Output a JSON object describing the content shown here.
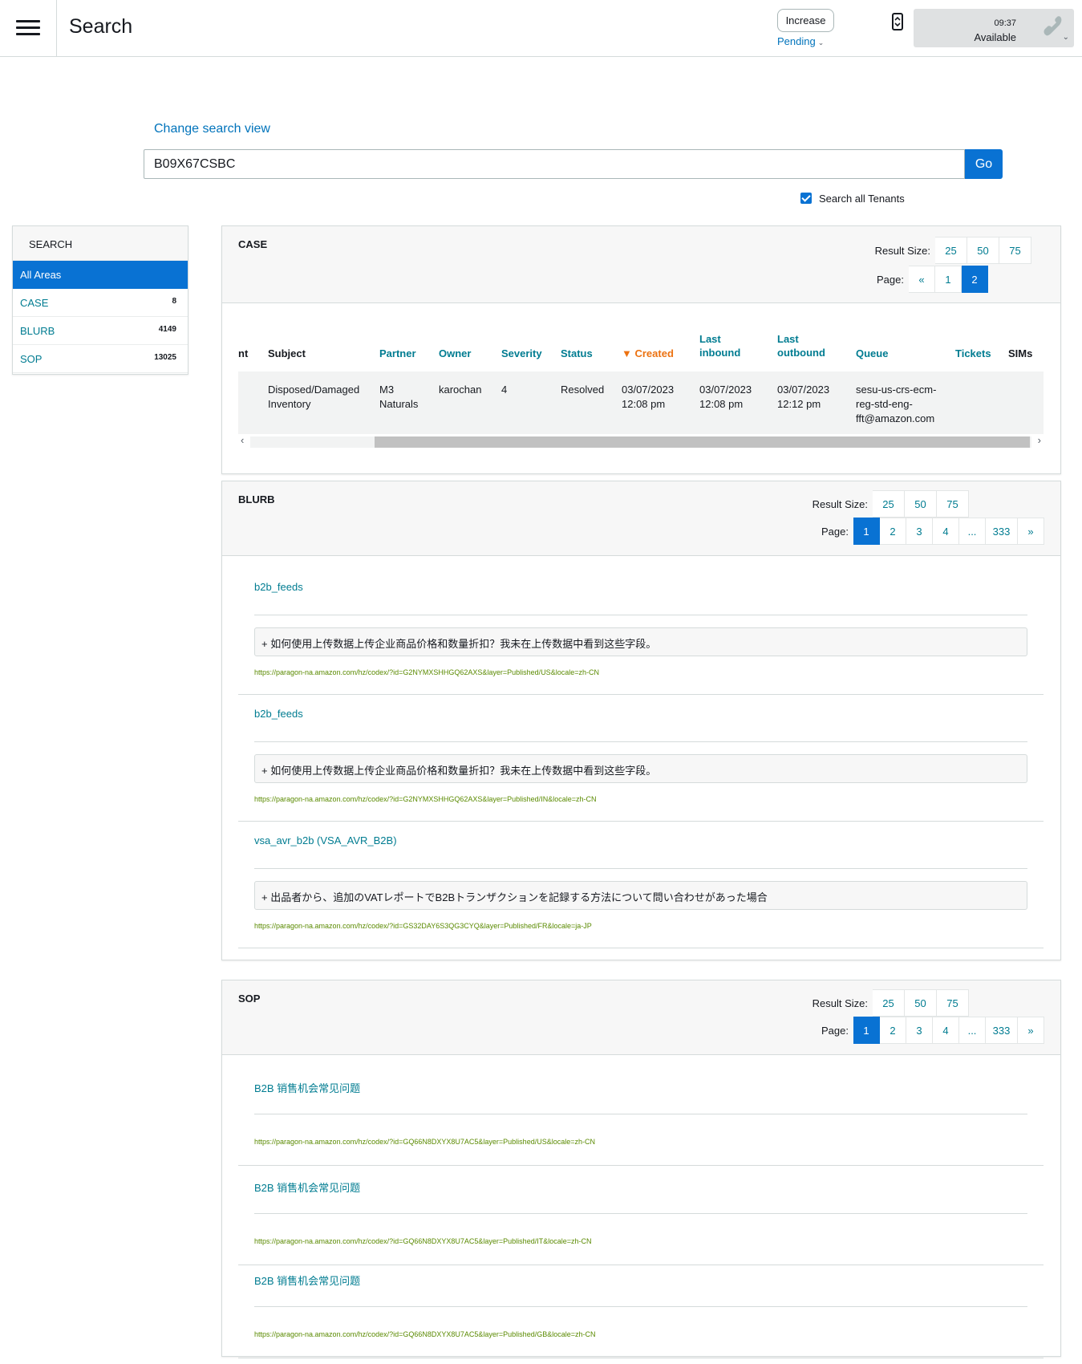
{
  "header": {
    "title": "Search",
    "increase_label": "Increase",
    "pending_label": "Pending",
    "status_time": "09:37",
    "status_text": "Available"
  },
  "search": {
    "change_view": "Change search view",
    "query": "B09X67CSBC",
    "go_label": "Go",
    "tenants_label": "Search all Tenants",
    "tenants_checked": true
  },
  "sidebar": {
    "heading": "SEARCH",
    "items": [
      {
        "label": "All Areas",
        "count": "",
        "active": true
      },
      {
        "label": "CASE",
        "count": "8"
      },
      {
        "label": "BLURB",
        "count": "4149"
      },
      {
        "label": "SOP",
        "count": "13025"
      }
    ]
  },
  "case_panel": {
    "title": "CASE",
    "result_size_label": "Result Size:",
    "result_sizes": [
      "25",
      "50",
      "75"
    ],
    "page_label": "Page:",
    "pages": [
      "«",
      "1",
      "2"
    ],
    "active_page": "2",
    "columns": {
      "c0": "nt",
      "subject": "Subject",
      "partner": "Partner",
      "owner": "Owner",
      "severity": "Severity",
      "status": "Status",
      "created": "▼ Created",
      "last_inbound_1": "Last",
      "last_inbound_2": "inbound",
      "last_outbound_1": "Last",
      "last_outbound_2": "outbound",
      "queue": "Queue",
      "tickets": "Tickets",
      "sims": "SIMs"
    },
    "row": {
      "subject_1": "Disposed/Damaged",
      "subject_2": "Inventory",
      "partner_1": "M3",
      "partner_2": "Naturals",
      "owner": "karochan",
      "severity": "4",
      "status": "Resolved",
      "created_1": "03/07/2023",
      "created_2": "12:08 pm",
      "inbound_1": "03/07/2023",
      "inbound_2": "12:08 pm",
      "outbound_1": "03/07/2023",
      "outbound_2": "12:12 pm",
      "queue_1": "sesu-us-crs-ecm-",
      "queue_2": "reg-std-eng-",
      "queue_3": "fft@amazon.com"
    }
  },
  "blurb_panel": {
    "title": "BLURB",
    "result_size_label": "Result Size:",
    "result_sizes": [
      "25",
      "50",
      "75"
    ],
    "page_label": "Page:",
    "pages": [
      "1",
      "2",
      "3",
      "4",
      "...",
      "333",
      "»"
    ],
    "active_page": "1",
    "entries": [
      {
        "title": "b2b_feeds",
        "question": "+ 如何使用上传数据上传企业商品价格和数量折扣？我未在上传数据中看到这些字段。",
        "url": "https://paragon-na.amazon.com/hz/codex/?id=G2NYMXSHHGQ62AXS&layer=Published/US&locale=zh-CN"
      },
      {
        "title": "b2b_feeds",
        "question": "+ 如何使用上传数据上传企业商品价格和数量折扣？我未在上传数据中看到这些字段。",
        "url": "https://paragon-na.amazon.com/hz/codex/?id=G2NYMXSHHGQ62AXS&layer=Published/IN&locale=zh-CN"
      },
      {
        "title": "vsa_avr_b2b (VSA_AVR_B2B)",
        "question": "+ 出品者から、追加のVATレポートでB2Bトランザクションを記録する方法について問い合わせがあった場合",
        "url": "https://paragon-na.amazon.com/hz/codex/?id=GS32DAY6S3QG3CYQ&layer=Published/FR&locale=ja-JP"
      }
    ]
  },
  "sop_panel": {
    "title": "SOP",
    "result_size_label": "Result Size:",
    "result_sizes": [
      "25",
      "50",
      "75"
    ],
    "page_label": "Page:",
    "pages": [
      "1",
      "2",
      "3",
      "4",
      "...",
      "333",
      "»"
    ],
    "active_page": "1",
    "entries": [
      {
        "title": "B2B 销售机会常见问题",
        "url": "https://paragon-na.amazon.com/hz/codex/?id=GQ66N8DXYX8U7AC5&layer=Published/US&locale=zh-CN"
      },
      {
        "title": "B2B 销售机会常见问题",
        "url": "https://paragon-na.amazon.com/hz/codex/?id=GQ66N8DXYX8U7AC5&layer=Published/IT&locale=zh-CN"
      },
      {
        "title": "B2B 销售机会常见问题",
        "url": "https://paragon-na.amazon.com/hz/codex/?id=GQ66N8DXYX8U7AC5&layer=Published/GB&locale=zh-CN"
      }
    ]
  },
  "icons": {
    "menu": "hamburger-menu-icon",
    "switch": "phone-switch-icon",
    "phone": "phone-handset-icon",
    "chevron": "chevron-down-icon",
    "check": "checkmark-icon"
  },
  "colors": {
    "accent": "#0972d3",
    "link": "#007c91",
    "sorted": "#ec7211",
    "url": "#5a8a00",
    "status_bg": "#dfe1e2"
  }
}
